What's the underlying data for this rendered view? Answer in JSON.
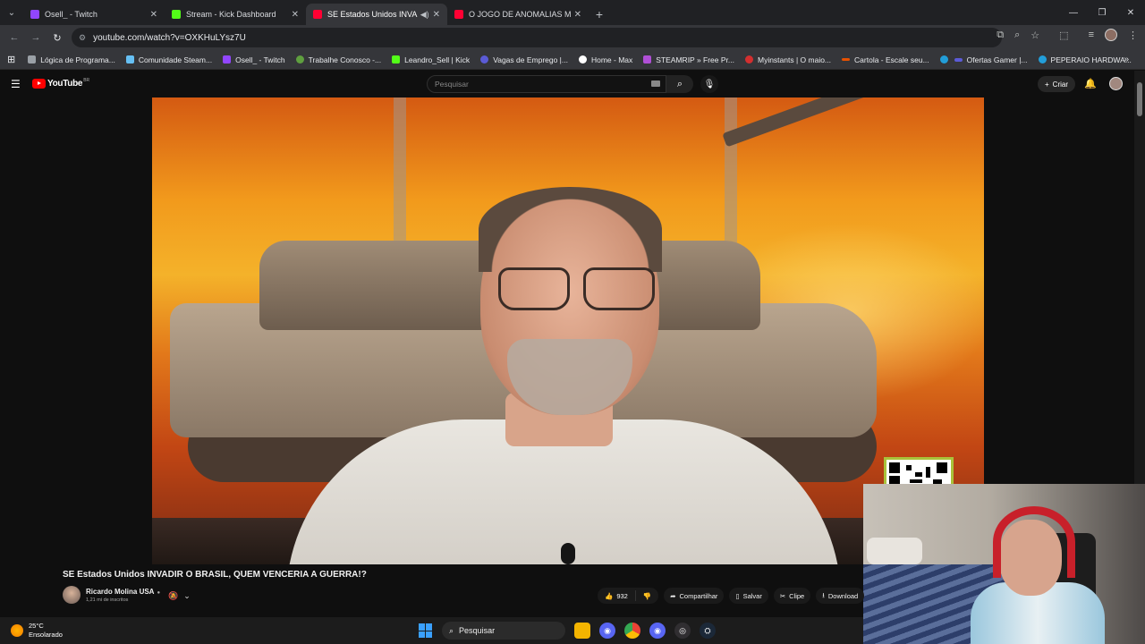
{
  "browser": {
    "tabs": [
      {
        "label": "Osell_ - Twitch",
        "color": "#9146ff",
        "active": false
      },
      {
        "label": "Stream - Kick Dashboard",
        "color": "#53fc18",
        "active": false
      },
      {
        "label": "SE Estados Unidos INVADIR",
        "color": "#ff0033",
        "active": true
      },
      {
        "label": "O JOGO DE ANOMALIAS MAIS",
        "color": "#ff0033",
        "active": false
      }
    ],
    "url": "youtube.com/watch?v=OXKHuLYsz7U"
  },
  "bookmarks": [
    {
      "label": "Lógica de Programa...",
      "color": "#9aa0a6"
    },
    {
      "label": "Comunidade Steam...",
      "color": "#66c0f4"
    },
    {
      "label": "Osell_ - Twitch",
      "color": "#9146ff"
    },
    {
      "label": "Trabalhe Conosco -...",
      "color": "#5f9f3f"
    },
    {
      "label": "Leandro_Sell | Kick",
      "color": "#53fc18"
    },
    {
      "label": "Vagas de Emprego |...",
      "color": "#5b5bd6"
    },
    {
      "label": "Home - Max",
      "color": "#ffffff"
    },
    {
      "label": "STEAMRIP » Free Pr...",
      "color": "#b04fd6"
    },
    {
      "label": "Myinstants | O maio...",
      "color": "#d32f2f"
    },
    {
      "label": "Cartola - Escale seu...",
      "color": "#e65100"
    },
    {
      "label": "",
      "color": "#229ed9"
    },
    {
      "label": "Ofertas Gamer |...",
      "color": "#5b5bd6"
    },
    {
      "label": "PEPERAIO HARDWA...",
      "color": "#229ed9"
    }
  ],
  "youtube": {
    "logo_text": "YouTube",
    "region": "BR",
    "search_placeholder": "Pesquisar",
    "create_label": "Criar"
  },
  "video": {
    "title": "SE Estados Unidos INVADIR O BRASIL, QUEM VENCERIA A GUERRA!?",
    "channel": "Ricardo Molina USA",
    "subscribers": "1,21 mi de inscritos",
    "likes": "932",
    "share_label": "Compartilhar",
    "save_label": "Salvar",
    "clip_label": "Clipe",
    "download_label": "Download"
  },
  "taskbar": {
    "temperature": "25°C",
    "weather": "Ensolarado",
    "search_label": "Pesquisar"
  },
  "colors": {
    "accent": "#ff0000",
    "background": "#0f0f0f"
  }
}
